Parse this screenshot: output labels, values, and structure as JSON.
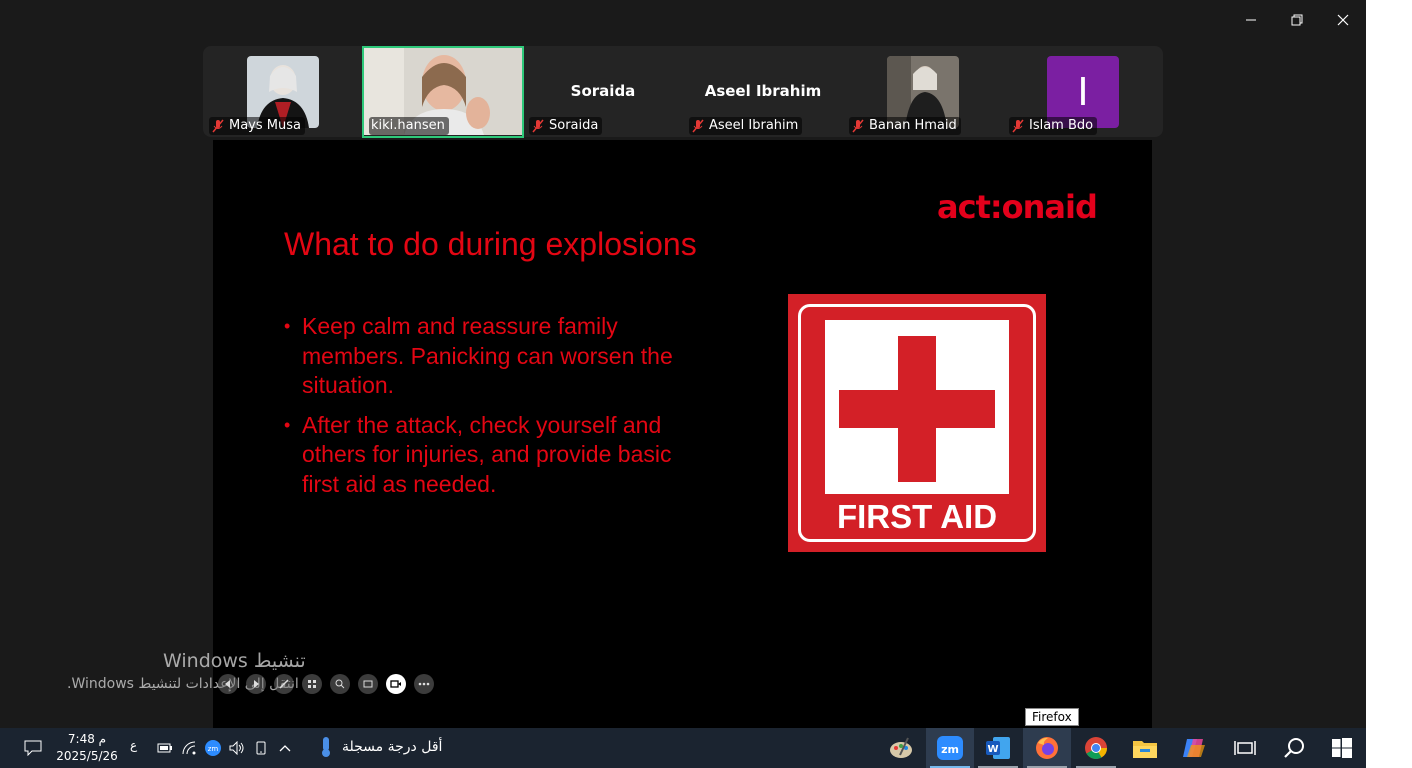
{
  "window": {
    "controls": [
      "minimize",
      "restore",
      "close"
    ]
  },
  "participants": [
    {
      "name": "Mays Musa",
      "muted": true,
      "display": "photo"
    },
    {
      "name": "kiki.hansen",
      "muted": false,
      "display": "video",
      "active": true
    },
    {
      "name": "Soraida",
      "muted": true,
      "display": "name",
      "big_name": "Soraida"
    },
    {
      "name": "Aseel Ibrahim",
      "muted": true,
      "display": "name",
      "big_name": "Aseel Ibrahim"
    },
    {
      "name": "Banan Hmaid",
      "muted": true,
      "display": "photo"
    },
    {
      "name": "Islam Bdo",
      "muted": true,
      "display": "initial",
      "initial": "I",
      "avatar_color": "#7b1fa2"
    }
  ],
  "slide": {
    "brand": "act:onaid",
    "title": "What to do during explosions",
    "bullets": [
      "Keep calm and reassure family members. Panicking can worsen the situation.",
      "After the attack, check yourself and others for injuries, and provide basic first aid as needed."
    ],
    "image_label": "FIRST AID",
    "accent_color": "#e30613"
  },
  "watermark": {
    "line1": "تنشيط Windows",
    "line2": "انتقل إلى الإعدادات لتنشيط Windows."
  },
  "tooltip": "Firefox",
  "taskbar": {
    "clock_time": "7:48 م",
    "clock_date": "2025/5/26",
    "lang": "ع",
    "weather_text": "أقل درجة مسجلة",
    "apps": [
      "start-icon",
      "search-icon",
      "task-view-icon",
      "copilot-icon",
      "file-explorer-icon",
      "chrome-icon",
      "firefox-icon",
      "word-icon",
      "zoom-icon",
      "paint-icon"
    ]
  }
}
